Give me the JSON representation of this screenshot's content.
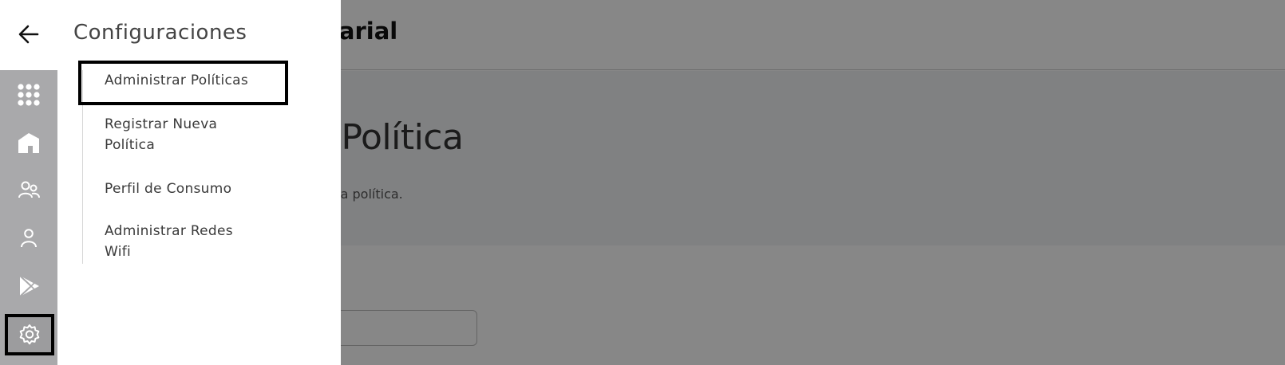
{
  "background": {
    "header_title_fragment": "esarial",
    "hero_title_fragment": "va Política",
    "hero_subtitle_fragment": "na nueva política."
  },
  "rail": {
    "back_icon": "arrow-left-icon",
    "items": [
      {
        "icon": "apps-grid-icon"
      },
      {
        "icon": "buildings-icon"
      },
      {
        "icon": "users-group-icon"
      },
      {
        "icon": "user-icon"
      },
      {
        "icon": "play-store-icon"
      },
      {
        "icon": "gear-icon",
        "active": true
      }
    ]
  },
  "panel": {
    "title": "Configuraciones",
    "items": [
      {
        "label": "Administrar Políticas",
        "selected": true
      },
      {
        "label": "Registrar Nueva Política"
      },
      {
        "label": "Perfil de Consumo"
      },
      {
        "label": "Administrar Redes Wifi"
      }
    ]
  },
  "colors": {
    "overlay": "#000000",
    "rail_bg": "#a9a9ab",
    "panel_bg": "#ffffff",
    "highlight_border": "#000000"
  }
}
